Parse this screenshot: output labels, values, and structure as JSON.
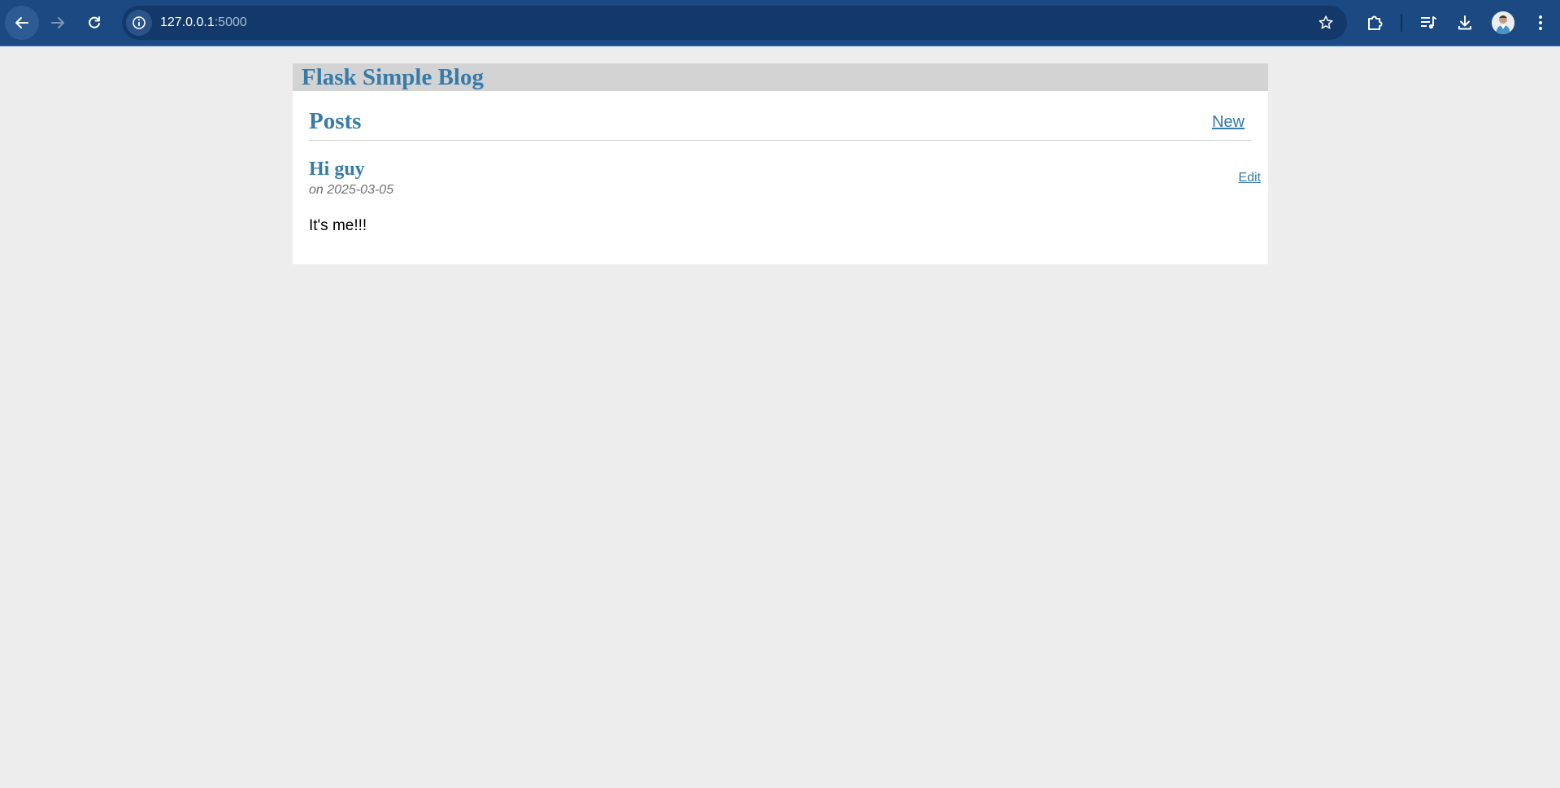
{
  "browser": {
    "url_host": "127.0.0.1",
    "url_port": ":5000",
    "icons": {
      "back": "back-arrow-icon",
      "forward": "forward-arrow-icon",
      "reload": "reload-icon",
      "site_info": "info-icon",
      "bookmark": "star-icon",
      "extensions": "puzzle-icon",
      "media": "media-queue-icon",
      "downloads": "download-icon",
      "profile": "avatar",
      "menu": "kebab-menu-icon"
    }
  },
  "site": {
    "title": "Flask Simple Blog"
  },
  "posts_section": {
    "heading": "Posts",
    "new_label": "New"
  },
  "posts": [
    {
      "title": "Hi guy",
      "about": "on 2025-03-05",
      "edit_label": "Edit",
      "body": "It's me!!!"
    }
  ],
  "colors": {
    "chrome": "#1b4a82",
    "omnibox": "#13396a",
    "page_background": "#ededed",
    "header_bar": "#d3d3d3",
    "accent": "#377ba8"
  }
}
